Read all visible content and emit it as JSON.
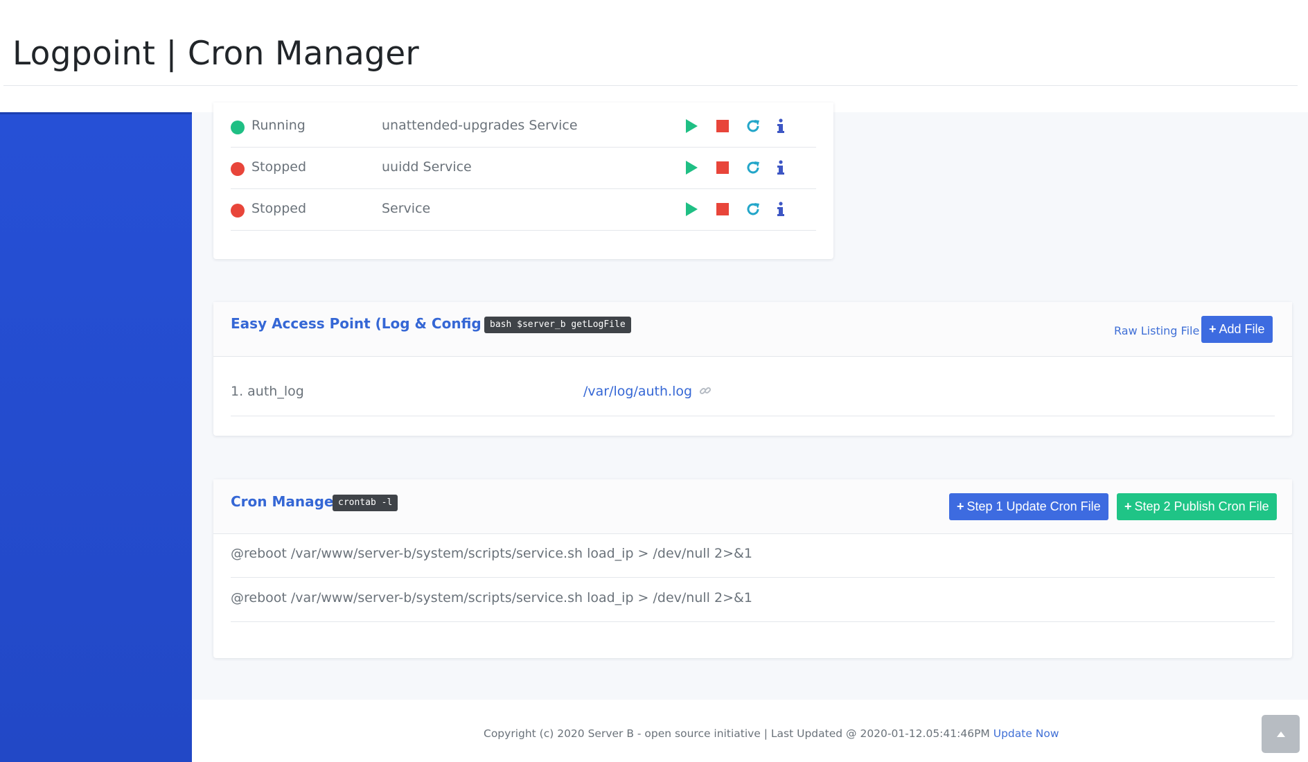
{
  "app": {
    "title": "Logpoint | Cron Manager"
  },
  "services": [
    {
      "status": "Running",
      "name": "unattended-upgrades Service",
      "status_color": "#1fbf84"
    },
    {
      "status": "Stopped",
      "name": "uuidd Service",
      "status_color": "#e8453a"
    },
    {
      "status": "Stopped",
      "name": "Service",
      "status_color": "#e8453a"
    }
  ],
  "actions": {
    "start_icon": "play-icon",
    "stop_icon": "stop-icon",
    "restart_icon": "restart-icon",
    "info_icon": "info-icon"
  },
  "easy_access": {
    "title": "Easy Access Point (Log & Config File)",
    "command": "bash $server_b getLogFile",
    "raw_link": "Raw Listing File",
    "add_button": "Add File",
    "files": [
      {
        "name": "1. auth_log",
        "path": "/var/log/auth.log"
      }
    ]
  },
  "cron": {
    "title": "Cron Manager",
    "command": "crontab -l",
    "step1": "Step 1 Update Cron File",
    "step2": "Step 2 Publish Cron File",
    "entries": [
      "@reboot /var/www/server-b/system/scripts/service.sh load_ip > /dev/null 2>&1",
      "@reboot /var/www/server-b/system/scripts/service.sh load_ip > /dev/null 2>&1"
    ]
  },
  "footer": {
    "text": "Copyright (c) 2020 Server B - open source initiative | Last Updated @ 2020-01-12.05:41:46PM",
    "link": "Update Now"
  },
  "colors": {
    "primary": "#3d6be0",
    "success": "#1fc486",
    "danger": "#e8453a",
    "sidebar": "#2650d6"
  }
}
